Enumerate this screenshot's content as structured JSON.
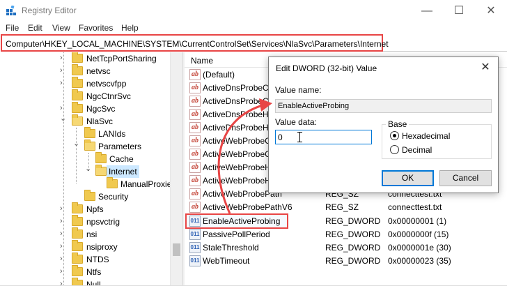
{
  "window": {
    "title": "Registry Editor",
    "min_glyph": "—",
    "max_glyph": "☐",
    "close_glyph": "✕"
  },
  "menu": {
    "file": "File",
    "edit": "Edit",
    "view": "View",
    "favorites": "Favorites",
    "help": "Help"
  },
  "address": {
    "path": "Computer\\HKEY_LOCAL_MACHINE\\SYSTEM\\CurrentControlSet\\Services\\NlaSvc\\Parameters\\Internet"
  },
  "tree": {
    "items": [
      {
        "label": "NetTcpPortSharing"
      },
      {
        "label": "netvsc"
      },
      {
        "label": "netvscvfpp"
      },
      {
        "label": "NgcCtnrSvc"
      },
      {
        "label": "NgcSvc"
      },
      {
        "label": "NlaSvc"
      },
      {
        "label": "LANIds"
      },
      {
        "label": "Parameters"
      },
      {
        "label": "Cache"
      },
      {
        "label": "Internet"
      },
      {
        "label": "ManualProxie"
      },
      {
        "label": "Security"
      },
      {
        "label": "Npfs"
      },
      {
        "label": "npsvctrig"
      },
      {
        "label": "nsi"
      },
      {
        "label": "nsiproxy"
      },
      {
        "label": "NTDS"
      },
      {
        "label": "Ntfs"
      },
      {
        "label": "Null"
      }
    ],
    "chevron_right": "›",
    "chevron_down": "⌄"
  },
  "list": {
    "header_name": "Name",
    "rows": [
      {
        "icon": "ab",
        "name": "(Default)",
        "type": "",
        "data": ""
      },
      {
        "icon": "ab",
        "name": "ActiveDnsProbeCo",
        "type": "",
        "data": ""
      },
      {
        "icon": "ab",
        "name": "ActiveDnsProbeCo",
        "type": "",
        "data": ""
      },
      {
        "icon": "ab",
        "name": "ActiveDnsProbeHo",
        "type": "",
        "data": ""
      },
      {
        "icon": "ab",
        "name": "ActiveDnsProbeHo",
        "type": "",
        "data": ""
      },
      {
        "icon": "ab",
        "name": "ActiveWebProbeC",
        "type": "",
        "data": ""
      },
      {
        "icon": "ab",
        "name": "ActiveWebProbeC",
        "type": "",
        "data": ""
      },
      {
        "icon": "ab",
        "name": "ActiveWebProbeH",
        "type": "",
        "data": ""
      },
      {
        "icon": "ab",
        "name": "ActiveWebProbeH",
        "type": "",
        "data": ""
      },
      {
        "icon": "ab",
        "name": "ActiveWebProbePath",
        "type": "REG_SZ",
        "data": "connecttest.txt"
      },
      {
        "icon": "ab",
        "name": "ActiveWebProbePathV6",
        "type": "REG_SZ",
        "data": "connecttest.txt"
      },
      {
        "icon": "011",
        "name": "EnableActiveProbing",
        "type": "REG_DWORD",
        "data": "0x00000001 (1)"
      },
      {
        "icon": "011",
        "name": "PassivePollPeriod",
        "type": "REG_DWORD",
        "data": "0x0000000f (15)"
      },
      {
        "icon": "011",
        "name": "StaleThreshold",
        "type": "REG_DWORD",
        "data": "0x0000001e (30)"
      },
      {
        "icon": "011",
        "name": "WebTimeout",
        "type": "REG_DWORD",
        "data": "0x00000023 (35)"
      }
    ]
  },
  "dialog": {
    "title": "Edit DWORD (32-bit) Value",
    "close_glyph": "✕",
    "value_name_label": "Value name:",
    "value_name": "EnableActiveProbing",
    "value_data_label": "Value data:",
    "value_data": "0",
    "base_label": "Base",
    "hex_label": "Hexadecimal",
    "dec_label": "Decimal",
    "ok_label": "OK",
    "cancel_label": "Cancel"
  },
  "colors": {
    "highlight": "#e84545",
    "selection": "#cce8ff",
    "accent": "#0078d7"
  }
}
